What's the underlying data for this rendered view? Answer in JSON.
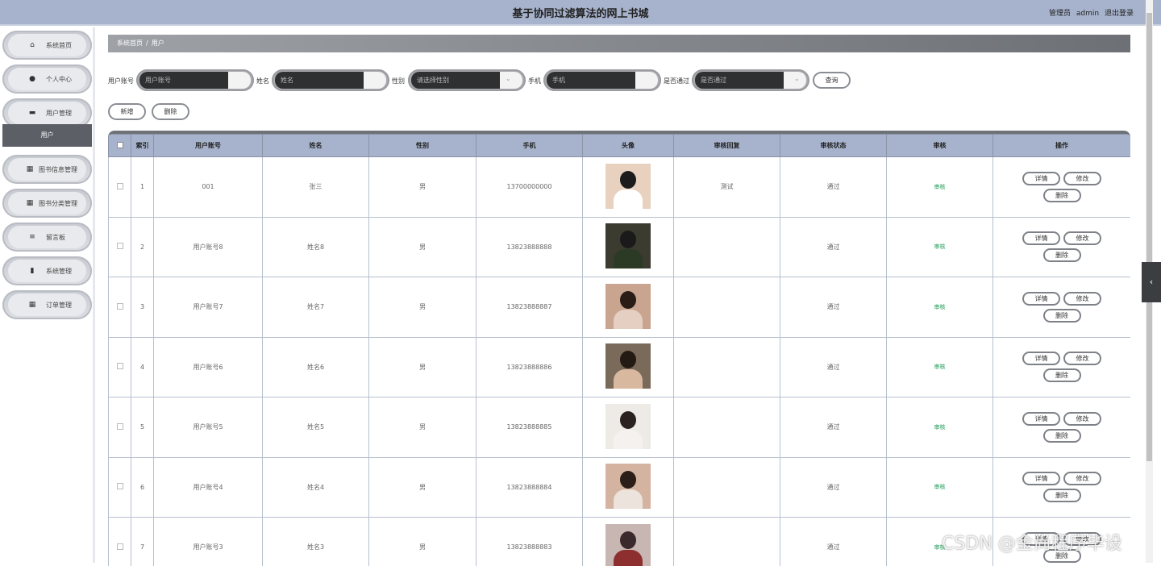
{
  "header": {
    "title": "基于协同过滤算法的网上书城",
    "role": "管理员",
    "username": "admin",
    "logout": "退出登录"
  },
  "sidebar": {
    "items": [
      {
        "label": "系统首页",
        "icon": "home-icon",
        "glyph": "⌂"
      },
      {
        "label": "个人中心",
        "icon": "person-icon",
        "glyph": "●"
      },
      {
        "label": "用户管理",
        "icon": "briefcase-icon",
        "glyph": "▬"
      },
      {
        "label": "图书信息管理",
        "icon": "grid-icon",
        "glyph": "▦"
      },
      {
        "label": "图书分类管理",
        "icon": "grid-icon",
        "glyph": "▦"
      },
      {
        "label": "留言板",
        "icon": "sliders-icon",
        "glyph": "≡"
      },
      {
        "label": "系统管理",
        "icon": "chart-icon",
        "glyph": "▮"
      },
      {
        "label": "订单管理",
        "icon": "grid-icon",
        "glyph": "▦"
      }
    ],
    "active_sub": "用户"
  },
  "breadcrumb": {
    "home": "系统首页",
    "sep": "/",
    "current": "用户"
  },
  "search": {
    "account_label": "用户账号",
    "account_placeholder": "用户账号",
    "name_label": "姓名",
    "name_placeholder": "姓名",
    "gender_label": "性别",
    "gender_placeholder": "请选择性别",
    "phone_label": "手机",
    "phone_placeholder": "手机",
    "passed_label": "是否通过",
    "passed_placeholder": "是否通过",
    "query_button": "查询"
  },
  "actions": {
    "add": "新增",
    "delete": "删除"
  },
  "table": {
    "columns": [
      "索引",
      "用户账号",
      "姓名",
      "性别",
      "手机",
      "头像",
      "审核回复",
      "审核状态",
      "审核",
      "操作"
    ],
    "rows": [
      {
        "index": "1",
        "account": "001",
        "name": "张三",
        "gender": "男",
        "phone": "13700000000",
        "reply": "测试",
        "status": "通过",
        "audit": "审核"
      },
      {
        "index": "2",
        "account": "用户账号8",
        "name": "姓名8",
        "gender": "男",
        "phone": "13823888888",
        "reply": "",
        "status": "通过",
        "audit": "审核"
      },
      {
        "index": "3",
        "account": "用户账号7",
        "name": "姓名7",
        "gender": "男",
        "phone": "13823888887",
        "reply": "",
        "status": "通过",
        "audit": "审核"
      },
      {
        "index": "4",
        "account": "用户账号6",
        "name": "姓名6",
        "gender": "男",
        "phone": "13823888886",
        "reply": "",
        "status": "通过",
        "audit": "审核"
      },
      {
        "index": "5",
        "account": "用户账号5",
        "name": "姓名5",
        "gender": "男",
        "phone": "13823888885",
        "reply": "",
        "status": "通过",
        "audit": "审核"
      },
      {
        "index": "6",
        "account": "用户账号4",
        "name": "姓名4",
        "gender": "男",
        "phone": "13823888884",
        "reply": "",
        "status": "通过",
        "audit": "审核"
      },
      {
        "index": "7",
        "account": "用户账号3",
        "name": "姓名3",
        "gender": "男",
        "phone": "13823888883",
        "reply": "",
        "status": "通过",
        "audit": "审核"
      }
    ],
    "op_detail": "详情",
    "op_edit": "修改",
    "op_delete": "删除"
  },
  "watermark": "CSDN @金尚程序毕设",
  "colors": {
    "header": "#a7b3cc",
    "audit": "#1b9a54",
    "active_sub": "#5c6066"
  }
}
